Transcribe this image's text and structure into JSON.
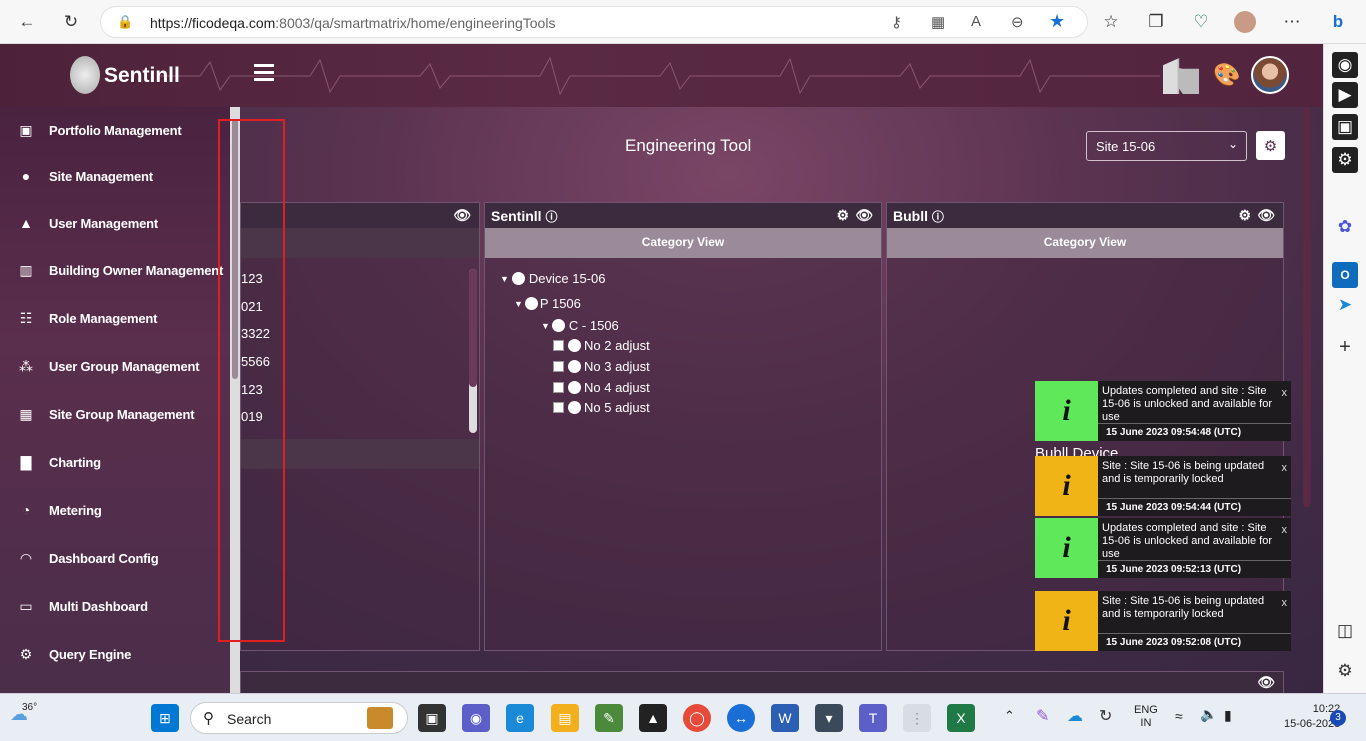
{
  "browser": {
    "url_host": "https://ficodeqa.com",
    "url_path": ":8003/qa/smartmatrix/home/engineeringTools"
  },
  "app": {
    "brand": "Sentinll",
    "page_title": "Engineering Tool",
    "site_select": "Site 15-06"
  },
  "sidebar": {
    "items": [
      {
        "label": "Portfolio Management",
        "icon": "portfolio-icon"
      },
      {
        "label": "Site Management",
        "icon": "globe-icon"
      },
      {
        "label": "User Management",
        "icon": "user-icon"
      },
      {
        "label": "Building Owner Management",
        "icon": "building-icon"
      },
      {
        "label": "Role Management",
        "icon": "hierarchy-icon"
      },
      {
        "label": "User Group Management",
        "icon": "users-icon"
      },
      {
        "label": "Site Group Management",
        "icon": "site-group-icon"
      },
      {
        "label": "Charting",
        "icon": "chart-icon"
      },
      {
        "label": "Metering",
        "icon": "gauge-icon"
      },
      {
        "label": "Dashboard Config",
        "icon": "dashboard-icon"
      },
      {
        "label": "Multi Dashboard",
        "icon": "monitor-icon"
      },
      {
        "label": "Query Engine",
        "icon": "gear-icon"
      }
    ]
  },
  "left_panel": {
    "list": [
      "123",
      "021",
      "3322",
      "5566",
      "123",
      "019"
    ]
  },
  "sentinll_panel": {
    "title": "Sentinll",
    "sub": "Category View",
    "device": "Device 15-06",
    "p": "P 1506",
    "c": "C - 1506",
    "points": [
      "No 2 adjust",
      "No 3 adjust",
      "No 4 adjust",
      "No 5 adjust"
    ]
  },
  "bubll_panel": {
    "title": "Bubll",
    "sub": "Category View",
    "partial": "Bubll Device"
  },
  "toasts": [
    {
      "msg": "Updates completed and site : Site 15-06 is unlocked and available for use",
      "date": "15 June 2023 09:54:48 (UTC)",
      "color": "#5ee85a"
    },
    {
      "msg": "Site : Site 15-06 is being updated and is temporarily locked",
      "date": "15 June 2023 09:54:44 (UTC)",
      "color": "#f0b417"
    },
    {
      "msg": "Updates completed and site : Site 15-06 is unlocked and available for use",
      "date": "15 June 2023 09:52:13 (UTC)",
      "color": "#5ee85a"
    },
    {
      "msg": "Site : Site 15-06 is being updated and is temporarily locked",
      "date": "15 June 2023 09:52:08 (UTC)",
      "color": "#f0b417"
    }
  ],
  "taskbar": {
    "temp": "36°",
    "search": "Search",
    "lang1": "ENG",
    "lang2": "IN",
    "time": "10:22",
    "date": "15-06-2023",
    "badge": "3"
  }
}
